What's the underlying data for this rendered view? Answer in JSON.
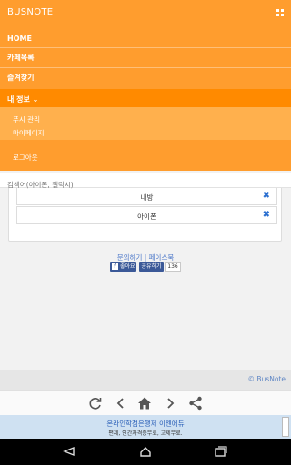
{
  "header": {
    "brand": "BUSNOTE"
  },
  "menu": {
    "home": "HOME",
    "cafe_list": "카페목록",
    "favorites": "즐겨찾기",
    "my_info": "내 정보 ⌄",
    "push_settings": "푸시 관리",
    "my_page": "마이페이지",
    "logout": "로그아웃"
  },
  "search": {
    "placeholder": "검색어(아이폰, 갤럭시)"
  },
  "list": {
    "items": [
      {
        "label": "내방"
      },
      {
        "label": "아이폰"
      }
    ]
  },
  "links": {
    "text": "문의하기 | 페이스북",
    "like": "좋아요",
    "share": "공유하기",
    "count": "136"
  },
  "footer": {
    "copyright": "© BusNote"
  },
  "ad": {
    "title": "온라인학점은행제 이젠에듀",
    "subtitle": "편제, 인간자격증무료, 고제무료."
  },
  "colors": {
    "accent": "#ff9d2e",
    "accent_dark": "#ff8a00",
    "link": "#4a76c8"
  }
}
